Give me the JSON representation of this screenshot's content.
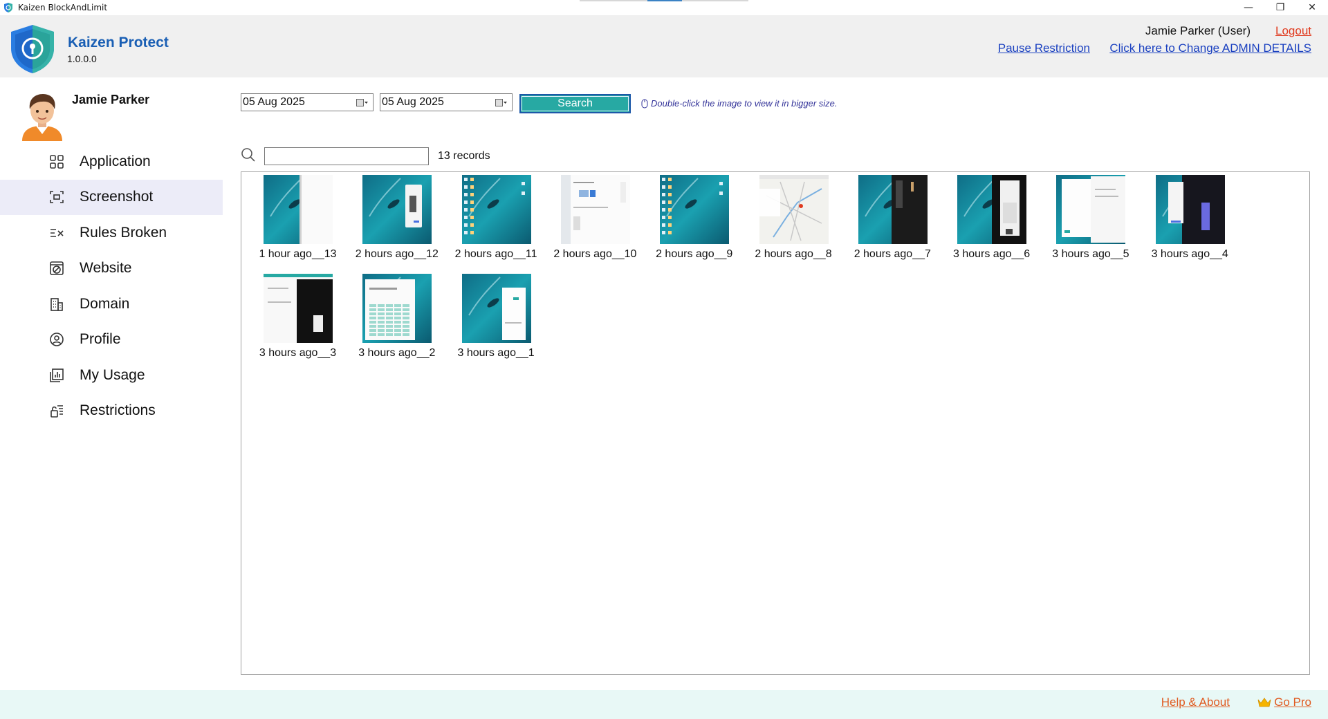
{
  "window": {
    "title": "Kaizen BlockAndLimit",
    "minimize": "—",
    "restore": "❐",
    "close": "✕"
  },
  "header": {
    "brand": "Kaizen Protect",
    "version": "1.0.0.0",
    "user": "Jamie Parker (User)",
    "logout": "Logout",
    "pause": "Pause Restriction",
    "admin": "Click here to Change ADMIN DETAILS"
  },
  "sidebar": {
    "profile_name": "Jamie Parker",
    "items": [
      {
        "label": "Application",
        "icon": "grid-icon"
      },
      {
        "label": "Screenshot",
        "icon": "screenshot-icon"
      },
      {
        "label": "Rules Broken",
        "icon": "rules-broken-icon"
      },
      {
        "label": "Website",
        "icon": "website-block-icon"
      },
      {
        "label": "Domain",
        "icon": "domain-icon"
      },
      {
        "label": "Profile",
        "icon": "profile-icon"
      },
      {
        "label": "My Usage",
        "icon": "usage-chart-icon"
      },
      {
        "label": "Restrictions",
        "icon": "restrictions-icon"
      }
    ],
    "active_index": 1
  },
  "toolbar": {
    "from_date": "05 Aug 2025",
    "to_date": "05 Aug 2025",
    "search_label": "Search",
    "hint": "Double-click the image to view it in bigger size.",
    "filter_value": "",
    "records": "13 records"
  },
  "screenshots": [
    {
      "label": "1 hour ago__13",
      "style": "desk-white-right"
    },
    {
      "label": "2 hours ago__12",
      "style": "desk-phone"
    },
    {
      "label": "2 hours ago__11",
      "style": "desk-icons"
    },
    {
      "label": "2 hours ago__10",
      "style": "doc-white"
    },
    {
      "label": "2 hours ago__9",
      "style": "desk-icons"
    },
    {
      "label": "2 hours ago__8",
      "style": "map"
    },
    {
      "label": "2 hours ago__7",
      "style": "desk-dark-right"
    },
    {
      "label": "3 hours ago__6",
      "style": "dark-panel"
    },
    {
      "label": "3 hours ago__5",
      "style": "white-panels"
    },
    {
      "label": "3 hours ago__4",
      "style": "dark-phone"
    },
    {
      "label": "3 hours ago__3",
      "style": "white-dark-split"
    },
    {
      "label": "3 hours ago__2",
      "style": "sheet"
    },
    {
      "label": "3 hours ago__1",
      "style": "desk-white-dialog"
    }
  ],
  "footer": {
    "help": "Help & About",
    "gopro": "Go Pro"
  },
  "colors": {
    "accent": "#27a9a3",
    "brand": "#1a5fb4",
    "link": "#1a40c0",
    "warn": "#e03a1e",
    "footer_link": "#e05a20"
  }
}
